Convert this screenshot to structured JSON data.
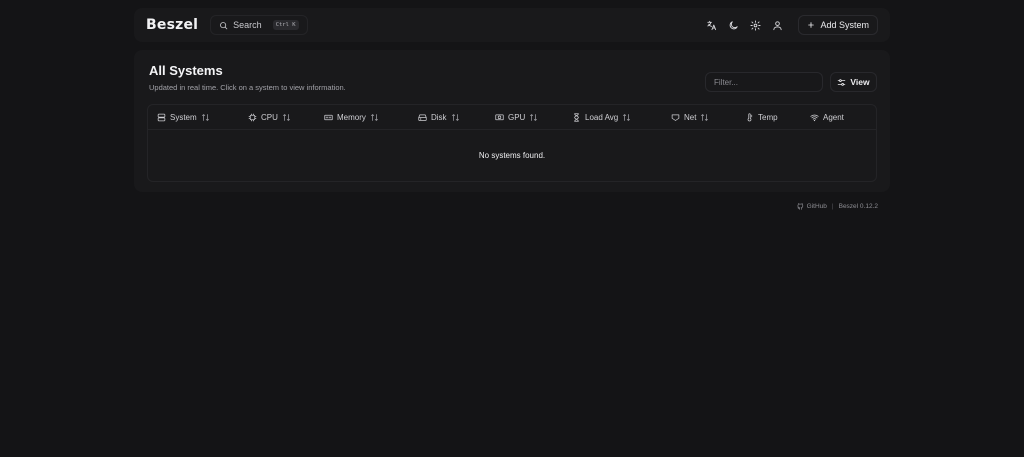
{
  "header": {
    "logo": "Beszel",
    "search_label": "Search",
    "search_shortcut": "Ctrl K",
    "add_system_label": "Add System"
  },
  "main": {
    "title": "All Systems",
    "subtitle": "Updated in real time. Click on a system to view information.",
    "filter_placeholder": "Filter...",
    "view_label": "View",
    "columns": [
      "System",
      "CPU",
      "Memory",
      "Disk",
      "GPU",
      "Load Avg",
      "Net",
      "Temp",
      "Agent"
    ],
    "empty_message": "No systems found."
  },
  "footer": {
    "github_label": "GitHub",
    "version": "Beszel 0.12.2"
  }
}
